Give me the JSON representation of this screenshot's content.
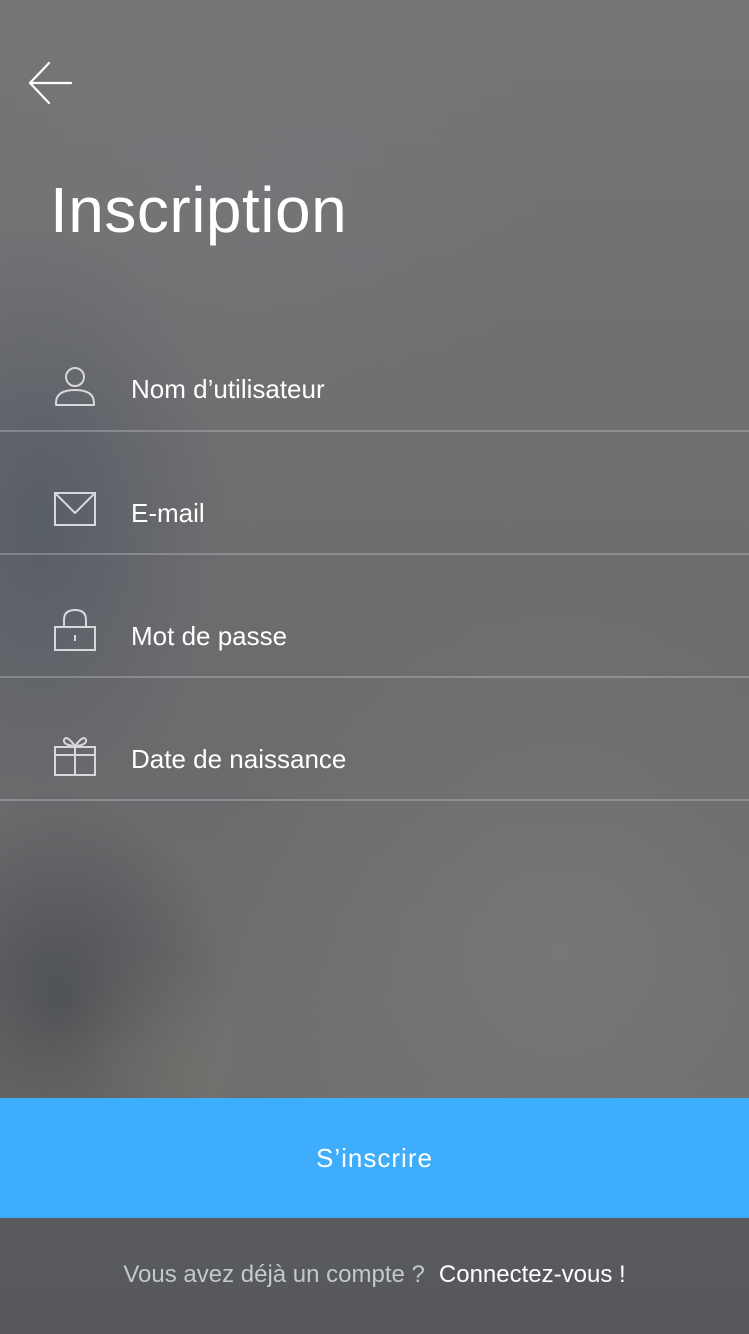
{
  "page": {
    "title": "Inscription"
  },
  "nav": {
    "back_icon": "arrow-left-icon"
  },
  "form": {
    "fields": [
      {
        "icon": "user-icon",
        "placeholder": "Nom d’utilisateur",
        "value": ""
      },
      {
        "icon": "envelope-icon",
        "placeholder": "E-mail",
        "value": ""
      },
      {
        "icon": "lock-icon",
        "placeholder": "Mot de passe",
        "value": ""
      },
      {
        "icon": "gift-icon",
        "placeholder": "Date de naissance",
        "value": ""
      }
    ],
    "submit_label": "S’inscrire"
  },
  "footer": {
    "prompt": "Vous avez déjà un compte ?",
    "link": "Connectez-vous !"
  },
  "colors": {
    "accent": "#3eadfb",
    "text": "#ffffff",
    "divider": "#c8c8cd"
  }
}
